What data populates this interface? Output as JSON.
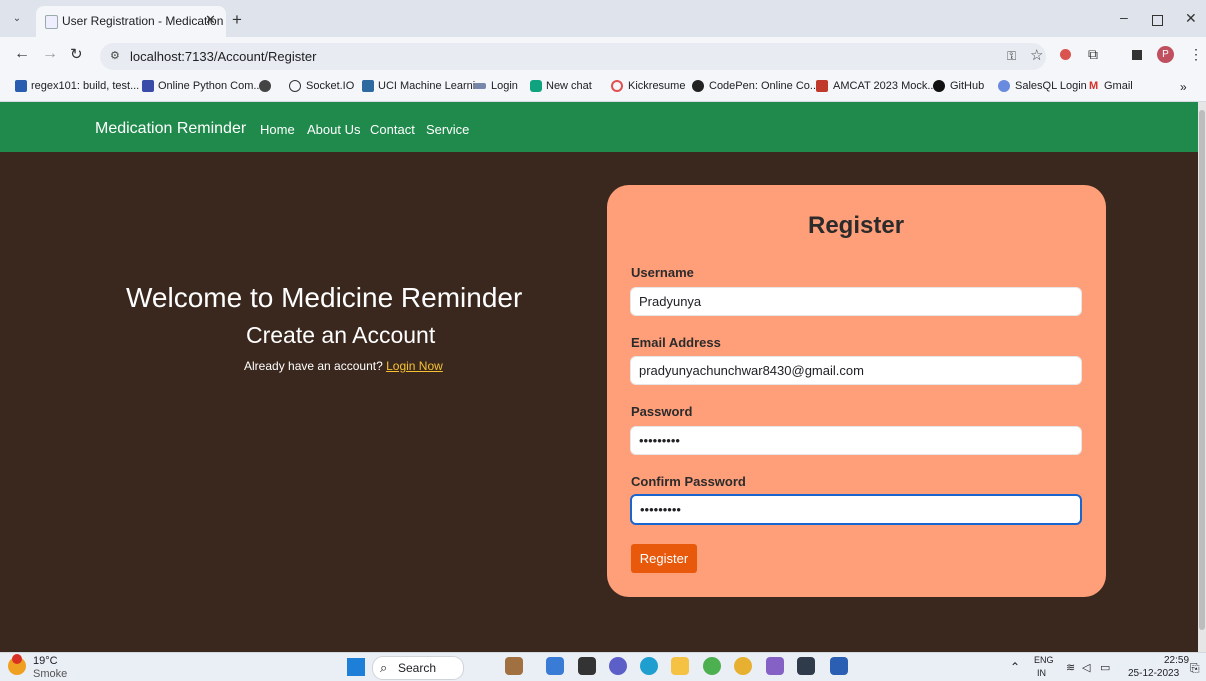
{
  "browser": {
    "tab_title": "User Registration - Medication",
    "url": "localhost:7133/Account/Register",
    "bookmarks": [
      "regex101: build, test...",
      "Online Python Com...",
      "Socket.IO",
      "UCI Machine Learni...",
      "Login",
      "New chat",
      "Kickresume",
      "CodePen: Online Co...",
      "AMCAT 2023 Mock...",
      "GitHub",
      "SalesQL Login",
      "Gmail"
    ]
  },
  "site_nav": {
    "brand": "Medication Reminder",
    "links": [
      "Home",
      "About Us",
      "Contact",
      "Service"
    ]
  },
  "hero": {
    "welcome": "Welcome to Medicine Reminder",
    "subtitle": "Create an Account",
    "already": "Already have an account?",
    "login_link": "Login Now"
  },
  "form": {
    "title": "Register",
    "fields": [
      {
        "label": "Username",
        "value": "Pradyunya"
      },
      {
        "label": "Email Address",
        "value": "pradyunyachunchwar8430@gmail.com"
      },
      {
        "label": "Password",
        "value": "•••••••••"
      },
      {
        "label": "Confirm Password",
        "value": "•••••••••"
      }
    ],
    "submit_label": "Register"
  },
  "taskbar": {
    "weather_temp": "19°C",
    "weather_text": "Smoke",
    "search_label": "Search",
    "lang": "ENG",
    "region": "IN",
    "time": "22:59",
    "date": "25-12-2023"
  },
  "colors": {
    "nav_green": "#1f8a4c",
    "page_bg": "#3a281e",
    "card": "#ff9f7a",
    "button": "#e8590c",
    "link": "#f6c232"
  }
}
